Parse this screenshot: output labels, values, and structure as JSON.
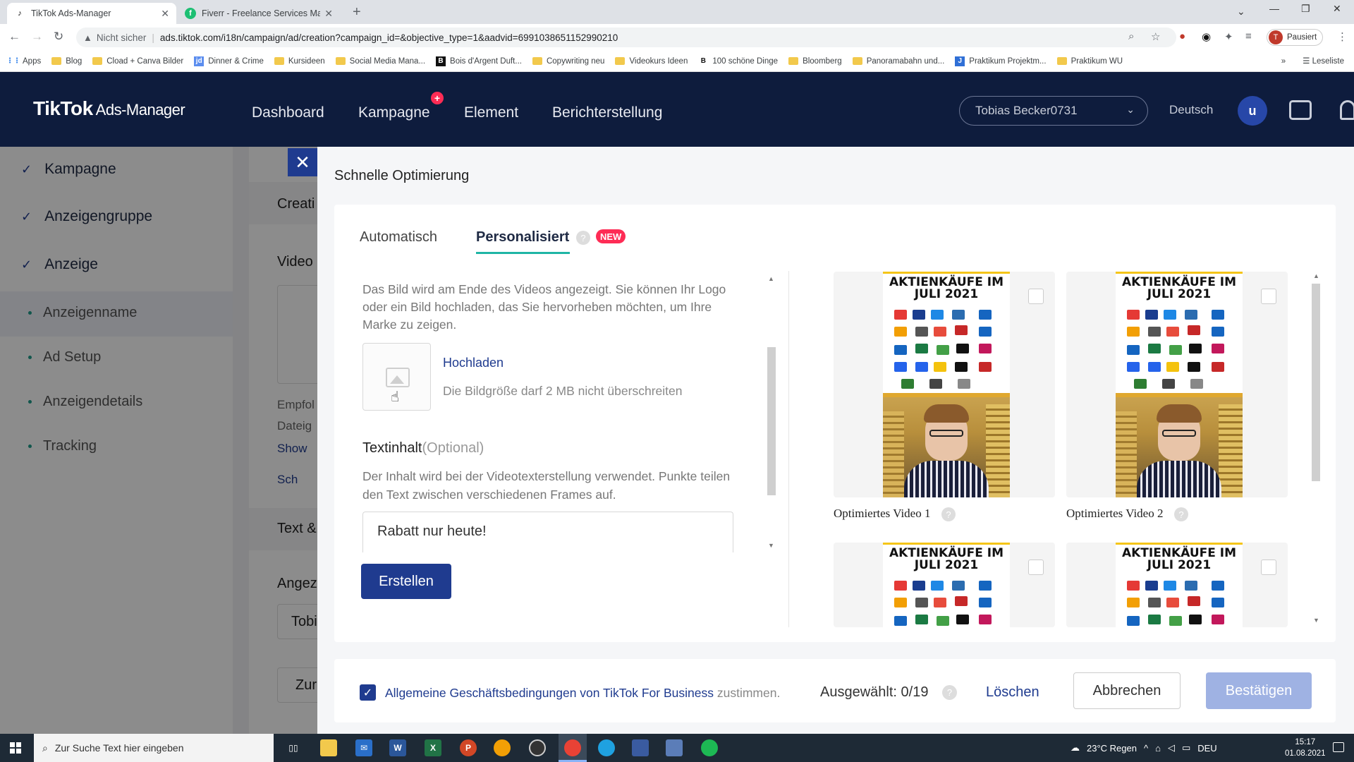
{
  "browser": {
    "tabs": [
      {
        "title": "TikTok Ads-Manager",
        "active": true
      },
      {
        "title": "Fiverr - Freelance Services Marke",
        "active": false
      }
    ],
    "address": {
      "security_label": "Nicht sicher",
      "url": "ads.tiktok.com/i18n/campaign/ad/creation?campaign_id=&objective_type=1&aadvid=6991038651152990210"
    },
    "profile": {
      "initial": "T",
      "label": "Pausiert"
    },
    "bookmarks": [
      "Apps",
      "Blog",
      "Cload + Canva Bilder",
      "Dinner & Crime",
      "Kursideen",
      "Social Media Mana...",
      "Bois d'Argent Duft...",
      "Copywriting neu",
      "Videokurs Ideen",
      "100 schöne Dinge",
      "Bloomberg",
      "Panoramabahn und...",
      "Praktikum Projektm...",
      "Praktikum WU"
    ],
    "reading_list": "Leseliste"
  },
  "header": {
    "logo": "TikTok",
    "logo_sub": "Ads-Manager",
    "nav": [
      "Dashboard",
      "Kampagne",
      "Element",
      "Berichterstellung"
    ],
    "account": "Tobias Becker0731",
    "language": "Deutsch",
    "user_initial": "u"
  },
  "sidebar": {
    "steps": [
      "Kampagne",
      "Anzeigengruppe",
      "Anzeige"
    ],
    "subitems": [
      "Anzeigenname",
      "Ad Setup",
      "Anzeigendetails",
      "Tracking"
    ]
  },
  "background": {
    "creati": "Creati",
    "video": "Video",
    "empfo": "Empfol",
    "dateig": "Dateig",
    "show": "Show",
    "sch": "Sch",
    "text": "Text &",
    "angez": "Angez",
    "tobi": "Tobi",
    "zur": "Zur"
  },
  "drawer": {
    "title": "Schnelle Optimierung",
    "tabs": {
      "auto": "Automatisch",
      "personal": "Personalisiert",
      "badge": "NEW"
    },
    "image_description": "Das Bild wird am Ende des Videos angezeigt. Sie können Ihr Logo oder ein Bild hochladen, das Sie hervorheben möchten, um Ihre Marke zu zeigen.",
    "upload_link": "Hochladen",
    "upload_hint": "Die Bildgröße darf 2 MB nicht überschreiten",
    "text_label": "Textinhalt",
    "text_optional": "(Optional)",
    "text_description": "Der Inhalt wird bei der Videotexterstellung verwendet. Punkte teilen den Text zwischen verschiedenen Frames auf.",
    "text_value": "Rabatt nur heute!",
    "create_button": "Erstellen",
    "videos": [
      {
        "label": "Optimiertes Video 1",
        "headline": "AKTIENKÄUFE IM JULI 2021"
      },
      {
        "label": "Optimiertes Video 2",
        "headline": "AKTIENKÄUFE IM JULI 2021"
      },
      {
        "label": "",
        "headline": "AKTIENKÄUFE IM JULI 2021"
      },
      {
        "label": "",
        "headline": "AKTIENKÄUFE IM JULI 2021"
      }
    ],
    "footer": {
      "terms_prefix": "Allgemeine Geschäftsbedingungen von TikTok For Business",
      "terms_suffix": "zustimmen.",
      "selected": "Ausgewählt: 0/19",
      "clear": "Löschen",
      "cancel": "Abbrechen",
      "confirm": "Bestätigen"
    }
  },
  "taskbar": {
    "search_placeholder": "Zur Suche Text hier eingeben",
    "weather": "23°C Regen",
    "lang": "DEU",
    "time": "15:17",
    "date": "01.08.2021"
  },
  "colors": {
    "brand_navy": "#0e1c3d",
    "primary": "#1f3b8f",
    "accent_teal": "#1fb5a5",
    "badge_red": "#fe2c55",
    "disabled": "#9fb2e3"
  }
}
